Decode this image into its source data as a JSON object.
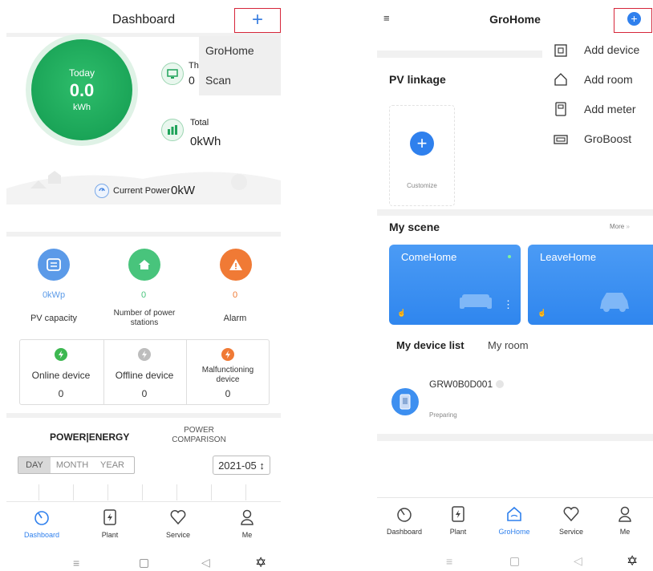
{
  "left": {
    "header_title": "Dashboard",
    "plus_label": "+",
    "dropdown": [
      "GroHome",
      "Scan"
    ],
    "gauge": {
      "today_label": "Today",
      "value": "0.0",
      "unit": "kWh"
    },
    "stat_top": {
      "label": "Th",
      "value": "0"
    },
    "stat_total": {
      "label": "Total",
      "value": "0kWh"
    },
    "current_power_label": "Current Power",
    "current_power_value": "0kW",
    "metrics": [
      {
        "value": "0kWp",
        "label": "PV capacity",
        "color": "#5b9ae8"
      },
      {
        "value": "0",
        "label": "Number of power stations",
        "color": "#48c47c"
      },
      {
        "value": "0",
        "label": "Alarm",
        "color": "#f07a35"
      }
    ],
    "devices": [
      {
        "label": "Online device",
        "count": "0",
        "color": "#3db851"
      },
      {
        "label": "Offline device",
        "count": "0",
        "color": "#bdbdbd"
      },
      {
        "label": "Malfunctioning device",
        "count": "0",
        "color": "#f07a35"
      }
    ],
    "tabs": {
      "power_energy": "POWER|ENERGY",
      "power_comparison": "POWER COMPARISON"
    },
    "range_tabs": [
      "DAY",
      "MONTH",
      "YEAR"
    ],
    "date_select": "2021-05 ↕",
    "nav": [
      {
        "label": "Dashboard",
        "active": true
      },
      {
        "label": "Plant",
        "active": false
      },
      {
        "label": "Service",
        "active": false
      },
      {
        "label": "Me",
        "active": false
      }
    ]
  },
  "right": {
    "header_title": "GroHome",
    "menu": [
      "Add device",
      "Add room",
      "Add meter",
      "GroBoost"
    ],
    "pv_linkage_title": "PV linkage",
    "customize_label": "Customize",
    "my_scene_title": "My scene",
    "more_label": "More",
    "scenes": [
      "ComeHome",
      "LeaveHome"
    ],
    "device_tabs": [
      "My device list",
      "My room"
    ],
    "device": {
      "name": "GRW0B0D001",
      "status": "Preparing"
    },
    "nav": [
      {
        "label": "Dashboard",
        "active": false
      },
      {
        "label": "Plant",
        "active": false
      },
      {
        "label": "GroHome",
        "active": true
      },
      {
        "label": "Service",
        "active": false
      },
      {
        "label": "Me",
        "active": false
      }
    ]
  },
  "colors": {
    "accent_blue": "#2f80ed",
    "gauge_green": "#1fa35a",
    "red_box": "#d6263a",
    "scene_blue": "#3d8ff0"
  }
}
